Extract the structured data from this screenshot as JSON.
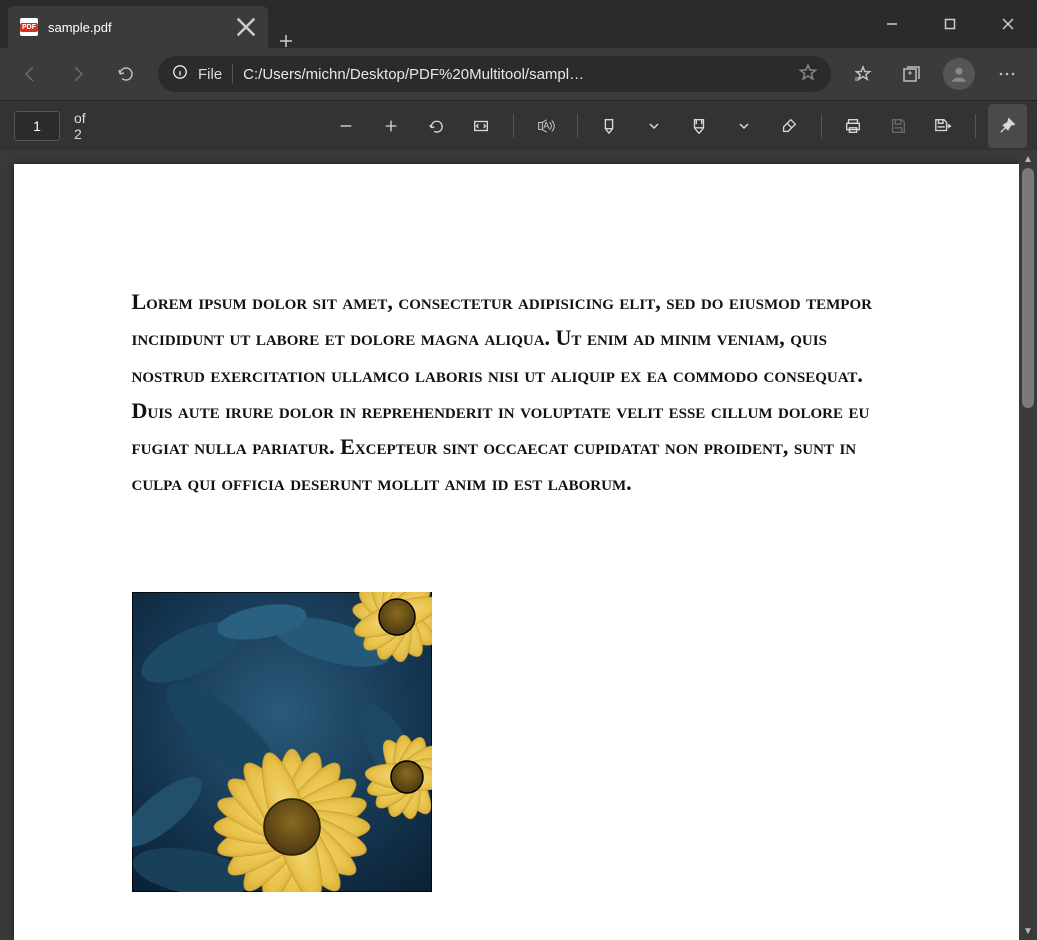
{
  "window": {
    "minimize_title": "Minimize",
    "maximize_title": "Maximize",
    "close_title": "Close"
  },
  "tab": {
    "title": "sample.pdf",
    "favicon_label": "PDF"
  },
  "nav": {
    "back_title": "Back",
    "forward_title": "Forward",
    "refresh_title": "Refresh"
  },
  "addressbar": {
    "file_label": "File",
    "url_display": "C:/Users/michn/Desktop/PDF%20Multitool/sampl…",
    "star_title": "Add to favorites",
    "favorites_title": "Favorites",
    "collections_title": "Collections",
    "profile_title": "Profile",
    "more_title": "Settings and more"
  },
  "pdf_toolbar": {
    "page_current": "1",
    "page_count_label": "of 2",
    "zoom_out_title": "Zoom out",
    "zoom_in_title": "Zoom in",
    "rotate_title": "Rotate",
    "fit_page_title": "Fit to page",
    "read_aloud_title": "Read aloud",
    "draw_title": "Draw",
    "highlight_title": "Highlight",
    "erase_title": "Erase",
    "print_title": "Print",
    "save_title": "Save",
    "saveas_title": "Save as",
    "pin_title": "Pin toolbar"
  },
  "document": {
    "paragraph": "Lorem ipsum dolor sit amet, consectetur adipisicing elit, sed do eiusmod tempor incididunt ut labore et dolore magna aliqua. Ut enim ad minim veniam, quis nostrud exercitation ullamco laboris nisi ut aliquip ex ea commodo consequat. Duis aute irure dolor in reprehenderit in voluptate velit esse cillum dolore eu fugiat nulla pariatur. Excepteur sint occaecat cupidatat non proident, sunt in culpa qui officia deserunt mollit anim id est laborum.",
    "image_alt": "Yellow daisy flowers with blue-green foliage"
  }
}
